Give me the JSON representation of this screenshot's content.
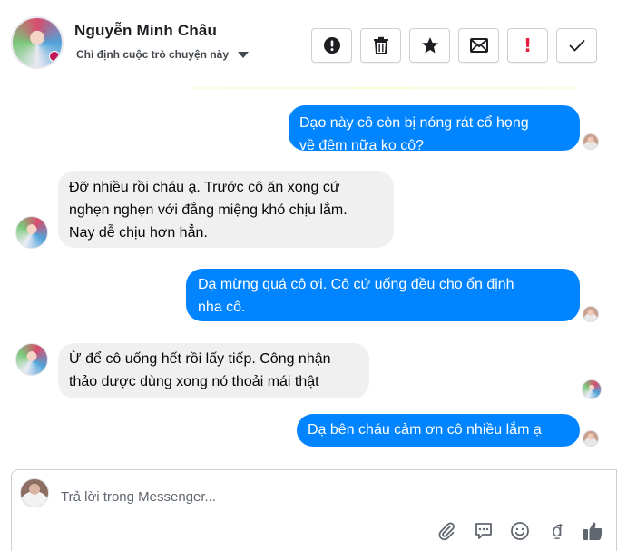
{
  "header": {
    "contact_name": "Nguyễn Minh Châu",
    "assign_label": "Chỉ định cuộc trò chuyện này"
  },
  "toolbar": {
    "buttons": [
      {
        "name": "spam-button",
        "icon": "exclamation-circle-icon"
      },
      {
        "name": "delete-button",
        "icon": "trash-icon"
      },
      {
        "name": "star-button",
        "icon": "star-icon"
      },
      {
        "name": "unread-button",
        "icon": "envelope-icon"
      },
      {
        "name": "follow-up-button",
        "icon": "exclamation-mark-icon",
        "color": "#e41e3f"
      },
      {
        "name": "done-button",
        "icon": "checkmark-icon"
      }
    ]
  },
  "messages": [
    {
      "direction": "out",
      "lines": [
        "Dạo này cô còn bị nóng rát cổ họng",
        "về đêm nữa ko cô?"
      ]
    },
    {
      "direction": "in",
      "lines": [
        "Đỡ nhiều rồi cháu ạ. Trước cô ăn xong cứ",
        "nghẹn nghẹn với đắng miệng khó chịu lắm.",
        "Nay dễ chịu hơn hẳn."
      ]
    },
    {
      "direction": "out",
      "lines": [
        "Dạ mừng quá cô ơi. Cô cứ uống đều cho ổn định",
        "nha cô."
      ]
    },
    {
      "direction": "in",
      "lines": [
        "Ừ để cô uống hết rồi lấy tiếp. Công nhận",
        "thảo dược dùng xong nó thoải mái thật"
      ]
    },
    {
      "direction": "out",
      "lines": [
        "Dạ bên cháu cảm ơn cô nhiều lắm ạ"
      ]
    }
  ],
  "composer": {
    "placeholder": "Trả lời trong Messenger...",
    "icons": [
      "paperclip-icon",
      "speech-bubble-icon",
      "emoji-icon",
      "dong-currency-icon",
      "thumbs-up-icon"
    ],
    "dong_symbol": "₫"
  },
  "colors": {
    "outgoing_bubble": "#0084ff",
    "incoming_bubble": "#f0f0f0",
    "icon_gray": "#606770"
  }
}
